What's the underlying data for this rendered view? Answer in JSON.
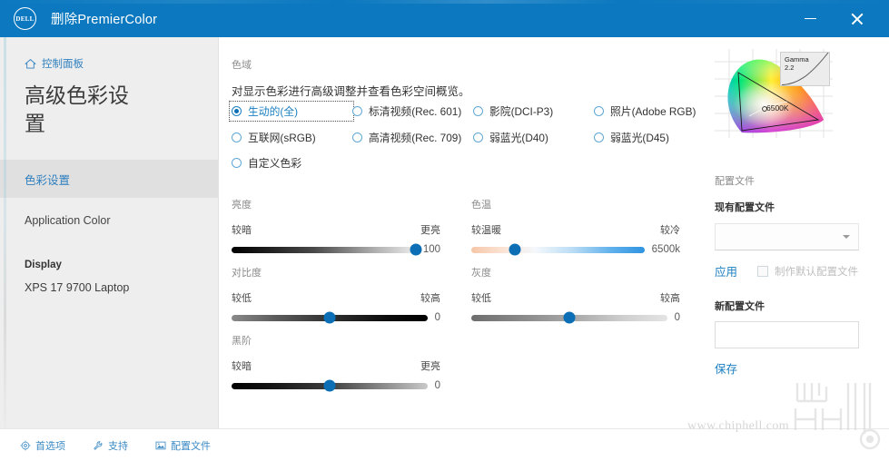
{
  "window": {
    "title": "删除PremierColor",
    "logo_text": "DELL",
    "minimize_label": "—",
    "close_label": "×"
  },
  "sidebar": {
    "breadcrumb": "控制面板",
    "breadcrumb_icon": "home-icon",
    "page_title": "高级色彩设置",
    "items": [
      {
        "label": "色彩设置",
        "selected": true
      },
      {
        "label": "Application Color",
        "selected": false
      }
    ],
    "display_section": "Display",
    "device": "XPS 17 9700 Laptop"
  },
  "gamut": {
    "label": "色域",
    "description": "对显示色彩进行高级调整并查看色彩空间概览。",
    "options": [
      {
        "label": "生动的(全)",
        "checked": true,
        "focused": true
      },
      {
        "label": "标清视频(Rec. 601)",
        "checked": false,
        "focused": false
      },
      {
        "label": "影院(DCI-P3)",
        "checked": false,
        "focused": false
      },
      {
        "label": "照片(Adobe RGB)",
        "checked": false,
        "focused": false
      },
      {
        "label": "互联网(sRGB)",
        "checked": false,
        "focused": false
      },
      {
        "label": "高清视频(Rec. 709)",
        "checked": false,
        "focused": false
      },
      {
        "label": "弱蓝光(D40)",
        "checked": false,
        "focused": false
      },
      {
        "label": "弱蓝光(D45)",
        "checked": false,
        "focused": false
      },
      {
        "label": "自定义色彩",
        "checked": false,
        "focused": false
      }
    ]
  },
  "sliders": {
    "brightness": {
      "title": "亮度",
      "min_label": "较暗",
      "max_label": "更亮",
      "value": "100",
      "percent": 100
    },
    "contrast": {
      "title": "对比度",
      "min_label": "较低",
      "max_label": "较高",
      "value": "0",
      "percent": 50
    },
    "black": {
      "title": "黑阶",
      "min_label": "较暗",
      "max_label": "更亮",
      "value": "0",
      "percent": 50
    },
    "temperature": {
      "title": "色温",
      "min_label": "较温暖",
      "max_label": "较冷",
      "value": "6500k",
      "percent": 25
    },
    "gray": {
      "title": "灰度",
      "min_label": "较低",
      "max_label": "较高",
      "value": "0",
      "percent": 50
    }
  },
  "diagram": {
    "gamma_label": "Gamma",
    "gamma_value": "2.2",
    "whitepoint_label": "6500K"
  },
  "profile": {
    "title": "配置文件",
    "existing_label": "现有配置文件",
    "existing_value": "",
    "dropdown_icon": "chevron-down-icon",
    "apply_label": "应用",
    "default_checkbox_label": "制作默认配置文件",
    "default_checkbox_checked": false,
    "new_label": "新配置文件",
    "new_value": "",
    "save_label": "保存"
  },
  "footer": {
    "items": [
      {
        "label": "首选项",
        "icon": "gear-icon"
      },
      {
        "label": "支持",
        "icon": "wrench-icon"
      },
      {
        "label": "配置文件",
        "icon": "image-icon"
      }
    ]
  },
  "watermark": {
    "text": "www.chiphell.com"
  },
  "colors": {
    "titlebar_blue": "#0b78bf",
    "accent_blue": "#1b7fc0",
    "thumb_blue": "#0c6fb5",
    "sidebar_bg": "#eeeeee",
    "selected_bg": "#e0e0e0"
  }
}
